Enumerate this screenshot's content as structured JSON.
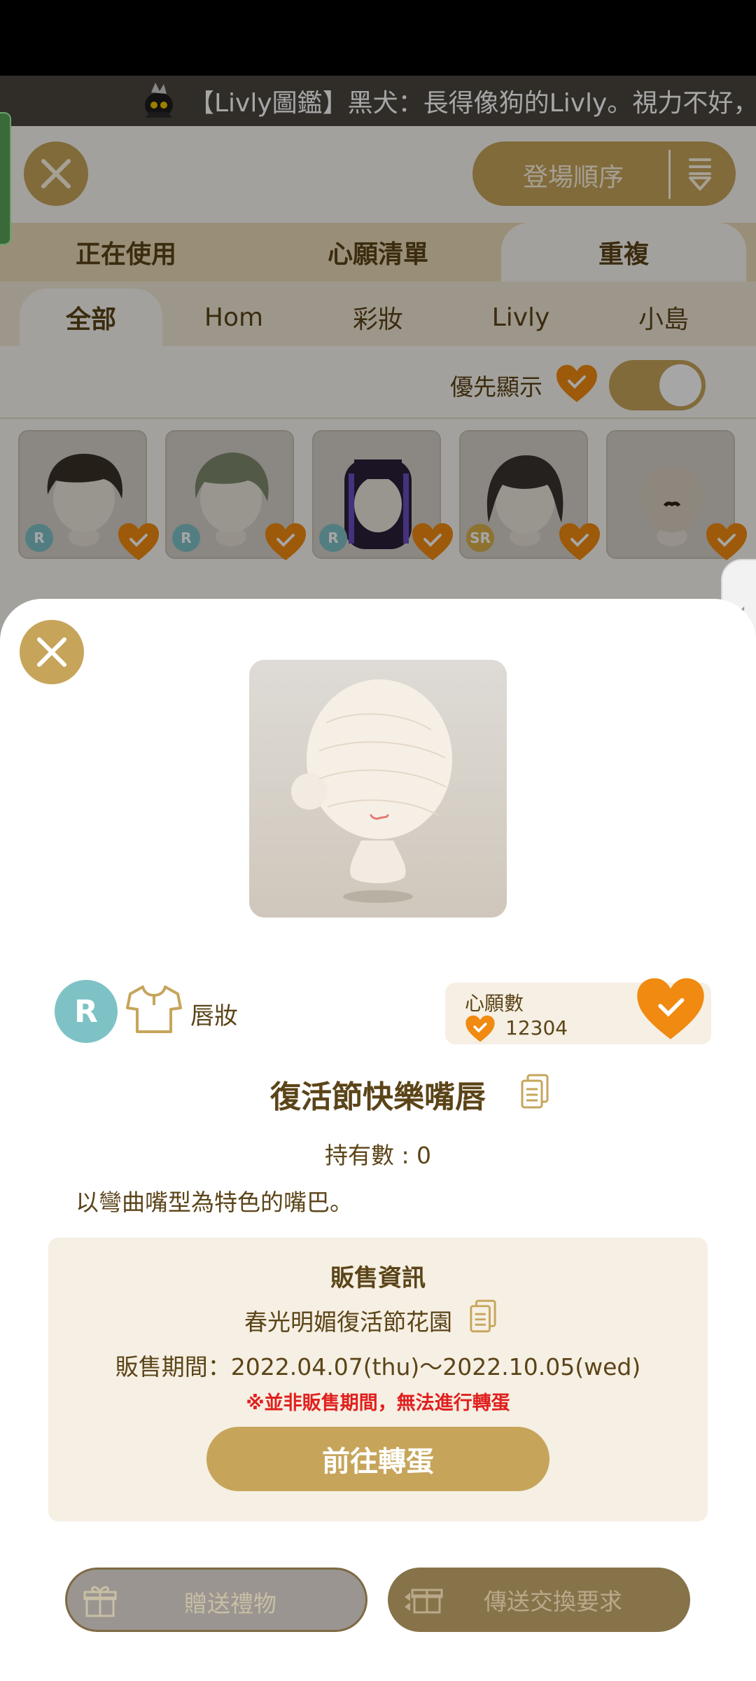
{
  "ticker": {
    "text": "【Livly圖鑑】黑犬：長得像狗的Livly。視力不好，但嗅"
  },
  "header": {
    "sort_label": "登場順序"
  },
  "tabs": [
    {
      "label": "正在使用"
    },
    {
      "label": "心願清單"
    },
    {
      "label": "重複",
      "active": true
    }
  ],
  "subtabs": [
    {
      "label": "全部",
      "active": true
    },
    {
      "label": "Hom"
    },
    {
      "label": "彩妝"
    },
    {
      "label": "Livly"
    },
    {
      "label": "小島"
    }
  ],
  "filter": {
    "label": "優先顯示",
    "toggle_on": true
  },
  "grid": {
    "items": [
      {
        "rarity": "R",
        "hair_color": "#3a3028"
      },
      {
        "rarity": "R",
        "hair_color": "#7f8a6e"
      },
      {
        "rarity": "R",
        "hair_color": "#2a1f3a"
      },
      {
        "rarity": "SR",
        "hair_color": "#3a3430"
      },
      {
        "rarity": "",
        "hair_color": "#d9cfc2"
      }
    ]
  },
  "detail": {
    "rarity": "R",
    "category": "唇妝",
    "wish_title": "心願數",
    "wish_count": "12304",
    "item_name": "復活節快樂嘴唇",
    "owned": "持有數 : 0",
    "description": "以彎曲嘴型為特色的嘴巴。",
    "sale": {
      "title": "販售資訊",
      "event": "春光明媚復活節花園",
      "period": "販售期間：2022.04.07(thu)～2022.10.05(wed)",
      "warning": "※並非販售期間，無法進行轉蛋",
      "gacha_button": "前往轉蛋"
    },
    "gift_button": "贈送禮物",
    "trade_button": "傳送交換要求"
  },
  "colors": {
    "accent_gold": "#c6a55b",
    "text_brown": "#5b4418",
    "heart_orange": "#f08a10",
    "warning_red": "#e0201e",
    "rarity_r": "#7ec2c6",
    "rarity_sr": "#d9b04a"
  }
}
